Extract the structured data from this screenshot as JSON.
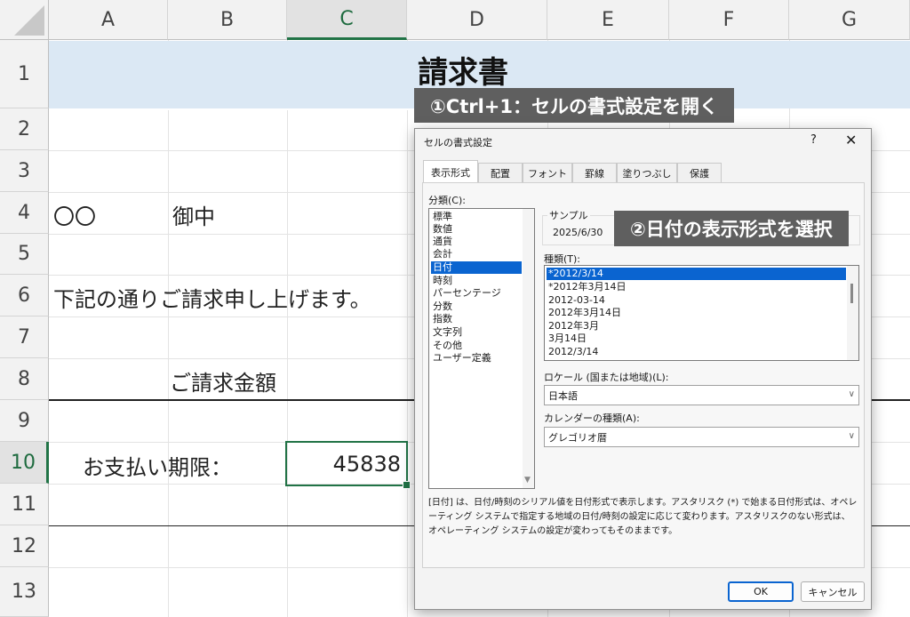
{
  "sheet": {
    "columns": [
      "A",
      "B",
      "C",
      "D",
      "E",
      "F",
      "G"
    ],
    "selected_column": "C",
    "rows": [
      "1",
      "2",
      "3",
      "4",
      "5",
      "6",
      "7",
      "8",
      "9",
      "10",
      "11",
      "12",
      "13"
    ],
    "selected_row": "10",
    "cells": {
      "title": "請求書",
      "recipient_mark": "〇〇",
      "recipient_honorific": "御中",
      "request_sentence": "下記の通りご請求申し上げます。",
      "amount_label": "ご請求金額",
      "due_label": "お支払い期限：",
      "due_value": "45838"
    }
  },
  "callouts": {
    "step1": "①Ctrl+1：セルの書式設定を開く",
    "step2": "②日付の表示形式を選択"
  },
  "dialog": {
    "title": "セルの書式設定",
    "help_label": "?",
    "close_label": "✕",
    "tabs": [
      "表示形式",
      "配置",
      "フォント",
      "罫線",
      "塗りつぶし",
      "保護"
    ],
    "active_tab": "表示形式",
    "category_label": "分類(C):",
    "categories": [
      "標準",
      "数値",
      "通貨",
      "会計",
      "日付",
      "時刻",
      "パーセンテージ",
      "分数",
      "指数",
      "文字列",
      "その他",
      "ユーザー定義"
    ],
    "selected_category": "日付",
    "sample_label": "サンプル",
    "sample_value": "2025/6/30",
    "type_label": "種類(T):",
    "types": [
      "*2012/3/14",
      "*2012年3月14日",
      "2012-03-14",
      "2012年3月14日",
      "2012年3月",
      "3月14日",
      "2012/3/14"
    ],
    "selected_type": "*2012/3/14",
    "locale_label": "ロケール (国または地域)(L):",
    "locale_value": "日本語",
    "calendar_label": "カレンダーの種類(A):",
    "calendar_value": "グレゴリオ暦",
    "description": "[日付] は、日付/時刻のシリアル値を日付形式で表示します。アスタリスク (*) で始まる日付形式は、オペレーティング システムで指定する地域の日付/時刻の設定に応じて変わります。アスタリスクのない形式は、オペレーティング システムの設定が変わってもそのままです。",
    "ok_label": "OK",
    "cancel_label": "キャンセル"
  },
  "colors": {
    "accent_green": "#217346",
    "title_band": "#dbe8f4",
    "callout_bg": "#5f5f5f",
    "selection_blue": "#0a64d0"
  }
}
